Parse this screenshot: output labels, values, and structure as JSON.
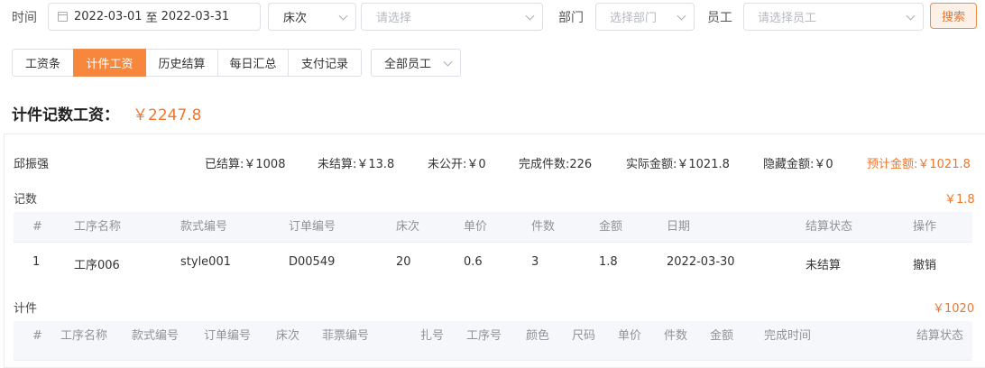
{
  "filters": {
    "time_label": "时间",
    "date_start": "2022-03-01",
    "date_sep": "至",
    "date_end": "2022-03-31",
    "bed_label": "床次",
    "bed_placeholder": "请选择",
    "dept_label": "部门",
    "dept_placeholder": "选择部门",
    "emp_label": "员工",
    "emp_placeholder": "请选择员工",
    "search_label": "搜索"
  },
  "tabs": [
    {
      "label": "工资条",
      "active": false
    },
    {
      "label": "计件工资",
      "active": true
    },
    {
      "label": "历史结算",
      "active": false
    },
    {
      "label": "每日汇总",
      "active": false
    },
    {
      "label": "支付记录",
      "active": false
    }
  ],
  "employee_filter": "全部员工",
  "summary": {
    "title": "计件记数工资：",
    "total": "￥2247.8"
  },
  "worker": {
    "name": "邱振强",
    "settled": "已结算:￥1008",
    "unsettled": "未结算:￥13.8",
    "unpublic": "未公开:￥0",
    "completed": "完成件数:226",
    "actual": "实际金额:￥1021.8",
    "hidden": "隐藏金额:￥0",
    "estimated": "预计金额:￥1021.8"
  },
  "count_section": {
    "label": "记数",
    "amount": "￥1.8",
    "headers": [
      "#",
      "工序名称",
      "款式编号",
      "订单编号",
      "床次",
      "单价",
      "件数",
      "金额",
      "日期",
      "结算状态",
      "操作"
    ],
    "rows": [
      {
        "idx": "1",
        "process": "工序006",
        "style": "style001",
        "order": "D00549",
        "bed": "20",
        "price": "0.6",
        "qty": "3",
        "amount": "1.8",
        "date": "2022-03-30",
        "status": "未结算",
        "action": "撤销"
      }
    ]
  },
  "piece_section": {
    "label": "计件",
    "amount": "￥1020",
    "headers": [
      "#",
      "工序名称",
      "款式编号",
      "订单编号",
      "床次",
      "菲票编号",
      "扎号",
      "工序号",
      "颜色",
      "尺码",
      "单价",
      "件数",
      "金额",
      "完成时间",
      "结算状态"
    ]
  },
  "colors": {
    "accent": "#f6873d",
    "accent_text": "#f0762b"
  }
}
